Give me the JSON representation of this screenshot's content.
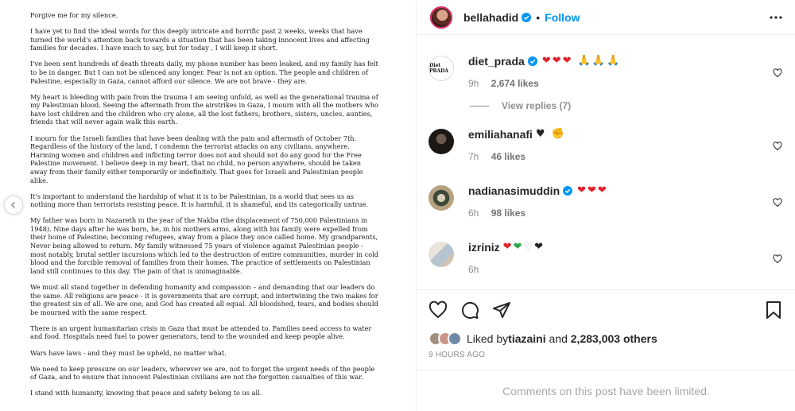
{
  "post": {
    "letter": [
      "Forgive me for my silence.",
      "I have yet to find the ideal words for this deeply intricate and horrific past 2 weeks, weeks that have turned the world's attention back towards a situation that has been taking innocent lives and affecting families for decades. I have much to say, but for today , I will keep it short.",
      "I've been sent hundreds of death threats daily, my phone number has been leaked, and my family has felt to be in danger. But I can not be silenced any longer. Fear is not an option. The people and children of Palestine, especially in Gaza, cannot afford our silence. We are not brave - they are.",
      " My heart is bleeding with pain from the trauma I am seeing unfold, as well as the generational trauma of my Palestinian blood. Seeing the aftermath from the airstrikes in Gaza, I mourn with all the mothers who have lost children and the children who cry alone, all the lost fathers, brothers, sisters, uncles, aunties, friends that will never again walk this earth.",
      "I mourn for the Israeli families that have been dealing with the pain and aftermath of October 7th. Regardless of the history of the land, I condemn the terrorist attacks on any civilians, anywhere. Harming women and children and inflicting terror does not and should not do any good for the Free Palestine movement. I believe deep in my heart, that no child, no person anywhere, should be taken away from their family either temporarily or indefinitely. That goes for Israeli and Palestinian people alike.",
      "It's important to understand the hardship of what it is to be Palestinian, in a world that sees us as nothing more than terrorists resisting peace. It is harmful, it is shameful, and its categorically untrue.",
      "My father was born in Nazareth in the year of the Nakba (the displacement of 750,000 Palestinians in 1948). Nine days after he was born, he, in his mothers arms, along with his family were expelled from their home of Palestine, becoming refugees, away from a place they once called home. My grandparents, Never being allowed to return. My family witnessed 75 years of violence against Palestinian people - most notably, brutal settler incursions which led to the destruction of entire communities, murder in cold blood and the forcible removal of families from their homes. The practice of settlements on Palestinian land still continues to this day. The pain of that is unimaginable.",
      "We must all stand together in defending humanity and compassion – and demanding that our leaders do the same.  All religions are peace - it is governments that are corrupt, and intertwining the two makes for the greatest sin of all. We are one, and God has created all equal.  All bloodshed, tears, and bodies should be mourned with the same respect.",
      "There is an urgent humanitarian crisis  in Gaza that must be attended to. Families need access to water and food. Hospitals need fuel to power generators, tend to the wounded and keep people alive.",
      "Wars have laws - and they must be upheld, no matter what.",
      "We need to keep pressure on our leaders, wherever we are, not to forget the urgent needs of the people of Gaza, and to ensure that innocent Palestinian civilians are not the forgotten casualties of this war.",
      "I stand with humanity, knowing that peace and safety belong to us all."
    ]
  },
  "header": {
    "username": "bellahadid",
    "follow_label": "Follow",
    "separator": "•"
  },
  "comments": [
    {
      "user": "diet_prada",
      "verified": true,
      "avatar_text": "Diet PRADA",
      "time": "9h",
      "likes": "2,674 likes"
    },
    {
      "user": "emiliahanafi",
      "verified": false,
      "time": "7h",
      "likes": "46 likes"
    },
    {
      "user": "nadianasimuddin",
      "verified": true,
      "time": "6h",
      "likes": "98 likes"
    },
    {
      "user": "izriniz",
      "verified": false,
      "time": "6h",
      "likes": ""
    }
  ],
  "view_replies_label": "View replies (7)",
  "liked_by": {
    "prefix": "Liked by ",
    "user": "tiazaini",
    "middle": " and ",
    "count": "2,283,003 others"
  },
  "timestamp": "9 HOURS AGO",
  "limited_notice": "Comments on this post have been limited.",
  "colors": {
    "accent": "#0095f6",
    "heart": "#e0242d",
    "muted": "#8e8e8e"
  }
}
